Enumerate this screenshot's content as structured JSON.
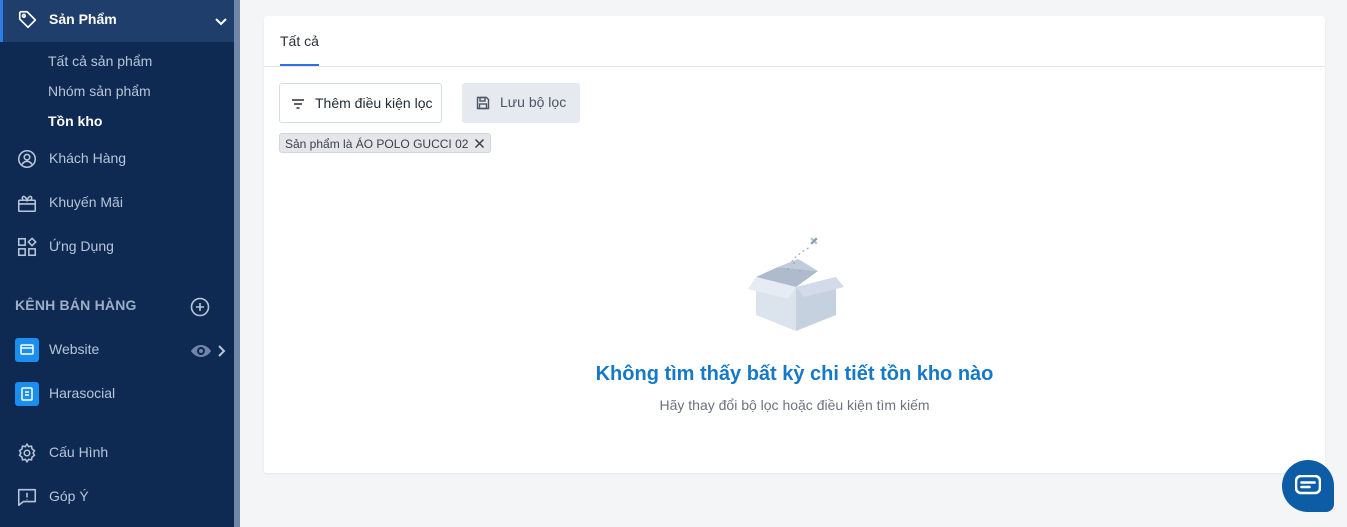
{
  "sidebar": {
    "top_item": {
      "label": "Sản Phẩm",
      "icon": "tag-icon"
    },
    "sub_items": [
      {
        "label": "Tất cả sản phẩm",
        "active": false
      },
      {
        "label": "Nhóm sản phẩm",
        "active": false
      },
      {
        "label": "Tồn kho",
        "active": true
      }
    ],
    "items": [
      {
        "label": "Khách Hàng",
        "icon": "user-circle-icon"
      },
      {
        "label": "Khuyến Mãi",
        "icon": "gift-icon"
      },
      {
        "label": "Ứng Dụng",
        "icon": "apps-icon"
      }
    ],
    "section_title": "KÊNH BÁN HÀNG",
    "channels": [
      {
        "label": "Website",
        "icon": "website-icon"
      },
      {
        "label": "Harasocial",
        "icon": "harasocial-icon"
      }
    ],
    "bottom_items": [
      {
        "label": "Cấu Hình",
        "icon": "gear-icon"
      },
      {
        "label": "Góp Ý",
        "icon": "feedback-icon"
      }
    ]
  },
  "main": {
    "tabs": [
      {
        "label": "Tất cả",
        "active": true
      }
    ],
    "filter_button": "Thêm điều kiện lọc",
    "save_button": "Lưu bộ lọc",
    "active_filter": "Sản phẩm là ÁO POLO GUCCI 02",
    "empty_title": "Không tìm thấy bất kỳ chi tiết tồn kho nào",
    "empty_subtitle": "Hãy thay đổi bộ lọc hoặc điều kiện tìm kiếm"
  },
  "colors": {
    "sidebar_bg": "#0e2a52",
    "accent": "#2d6fe0",
    "empty_title": "#1479c8",
    "chat_bubble": "#0d5ca6"
  }
}
